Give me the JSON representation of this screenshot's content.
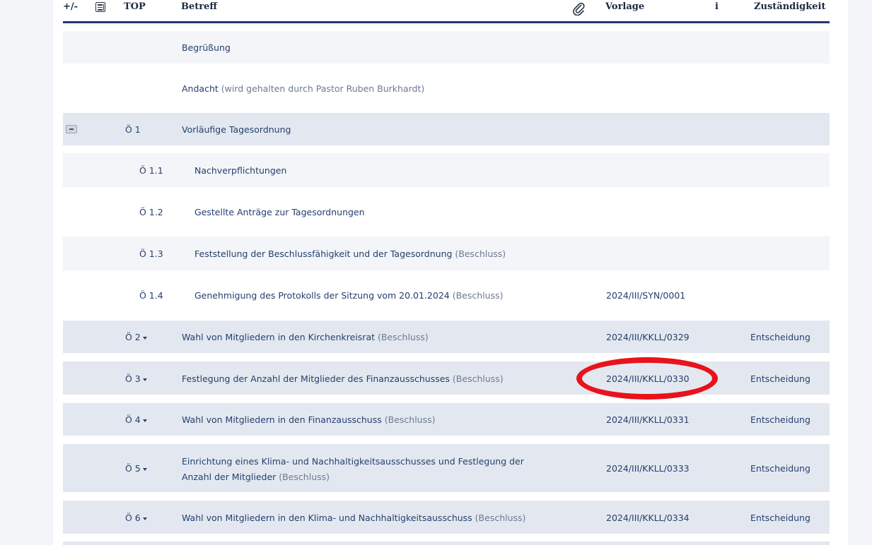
{
  "header": {
    "toggle": "+/-",
    "top": "TOP",
    "betreff": "Betreff",
    "attachment_icon": "paperclip-icon",
    "vorlage": "Vorlage",
    "info": "i",
    "zustaendigkeit": "Zuständigkeit",
    "list_icon": "list-icon"
  },
  "rows": [
    {
      "top": "",
      "betreff": "Begrüßung",
      "suffix": "",
      "vorlage": "",
      "zust": ""
    },
    {
      "top": "",
      "betreff": "Andacht",
      "suffix": " (wird gehalten durch Pastor Ruben Burkhardt)",
      "vorlage": "",
      "zust": ""
    },
    {
      "top": "Ö 1",
      "betreff": "Vorläufige Tagesordnung",
      "suffix": "",
      "vorlage": "",
      "zust": ""
    },
    {
      "top": "Ö 1.1",
      "betreff": "Nachverpflichtungen",
      "suffix": "",
      "vorlage": "",
      "zust": ""
    },
    {
      "top": "Ö 1.2",
      "betreff": "Gestellte Anträge zur Tagesordnungen",
      "suffix": "",
      "vorlage": "",
      "zust": ""
    },
    {
      "top": "Ö 1.3",
      "betreff": "Feststellung der Beschlussfähigkeit und der Tagesordnung",
      "suffix": " (Beschluss)",
      "vorlage": "",
      "zust": ""
    },
    {
      "top": "Ö 1.4",
      "betreff": "Genehmigung des Protokolls der Sitzung vom 20.01.2024",
      "suffix": " (Beschluss)",
      "vorlage": "2024/III/SYN/0001",
      "zust": ""
    },
    {
      "top": "Ö 2",
      "betreff": "Wahl von Mitgliedern in den Kirchenkreisrat",
      "suffix": " (Beschluss)",
      "vorlage": "2024/III/KKLL/0329",
      "zust": "Entscheidung"
    },
    {
      "top": "Ö 3",
      "betreff": "Festlegung der Anzahl der Mitglieder des Finanzausschusses",
      "suffix": " (Beschluss)",
      "vorlage": "2024/III/KKLL/0330",
      "zust": "Entscheidung"
    },
    {
      "top": "Ö 4",
      "betreff": "Wahl von Mitgliedern in den Finanzausschuss",
      "suffix": " (Beschluss)",
      "vorlage": "2024/III/KKLL/0331",
      "zust": "Entscheidung"
    },
    {
      "top": "Ö 5",
      "betreff": "Einrichtung eines Klima- und Nachhaltigkeitsausschusses und Festlegung der",
      "betreff2": "Anzahl der Mitglieder",
      "suffix": " (Beschluss)",
      "vorlage": "2024/III/KKLL/0333",
      "zust": "Entscheidung"
    },
    {
      "top": "Ö 6",
      "betreff": "Wahl von Mitgliedern in den Klima- und Nachhaltigkeitsausschuss",
      "suffix": " (Beschluss)",
      "vorlage": "2024/III/KKLL/0334",
      "zust": "Entscheidung"
    }
  ],
  "annotation": {
    "color": "#e8131b"
  }
}
